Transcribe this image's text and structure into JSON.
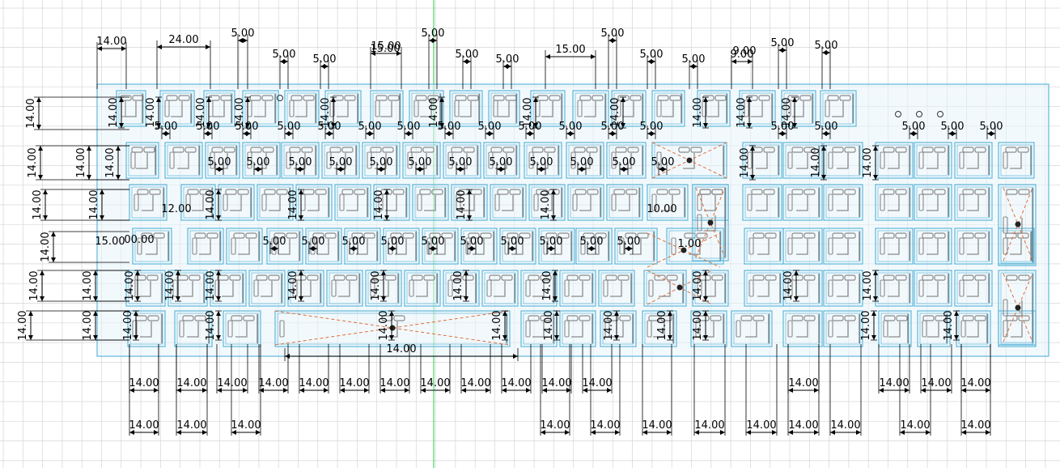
{
  "view": {
    "colors": {
      "background": "#ffffff",
      "grid": "#d6d6d6",
      "axis": "#22cc44",
      "panel_fill": "#e8f4fb",
      "panel_outline": "#5fb7d9",
      "key_outline": "#5fb7d9",
      "switch_body": "#8a8a8a",
      "dimension_line": "#000000",
      "construction_line": "#e0703a"
    }
  },
  "dimensions": {
    "unit_label": "14.00",
    "gap_label": "5.00",
    "top_row_labels": [
      "14.00",
      "24.00",
      "5.00",
      "5.00",
      "5.00",
      "15.00",
      "5.00",
      "5.00",
      "5.00",
      "15.00",
      "5.00",
      "5.00",
      "5.00",
      "9.00",
      "5.00",
      "5.00"
    ],
    "misc_labels": [
      "10.00",
      "1.00",
      "12.00",
      "15.00",
      "00.00",
      "9.00",
      "15.00"
    ],
    "bottom_row_1": [
      "14.00",
      "14.00",
      "14.00",
      "14.00",
      "14.00",
      "14.00",
      "14.00",
      "14.00",
      "14.00",
      "14.00",
      "14.00",
      "14.00",
      "14.00",
      "14.00",
      "14.00",
      "14.00",
      "14.00",
      "14.00"
    ],
    "bottom_row_2": [
      "14.00",
      "14.00",
      "14.00",
      "14.00",
      "14.00",
      "14.00",
      "14.00",
      "14.00",
      "14.00",
      "14.00",
      "14.00",
      "14.00",
      "14.00"
    ],
    "left_labels": [
      "14.00",
      "14.00",
      "14.00",
      "14.00",
      "14.00",
      "14.00"
    ]
  }
}
